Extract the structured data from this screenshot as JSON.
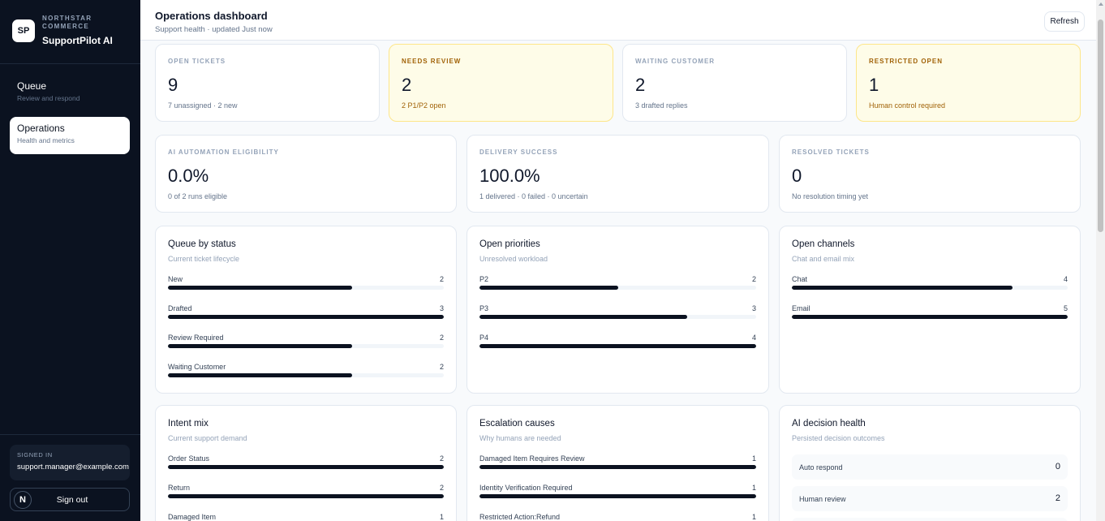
{
  "sidebar": {
    "logo": "SP",
    "org": "NORTHSTAR COMMERCE",
    "app_name": "SupportPilot AI",
    "nav": [
      {
        "label": "Queue",
        "sub": "Review and respond"
      },
      {
        "label": "Operations",
        "sub": "Health and metrics"
      }
    ],
    "signed_in_label": "SIGNED IN",
    "email": "support.manager@example.com",
    "avatar_letter": "N",
    "sign_out": "Sign out"
  },
  "header": {
    "title": "Operations dashboard",
    "subtitle": "Support health · updated Just now",
    "refresh": "Refresh"
  },
  "stats_top": [
    {
      "label": "OPEN TICKETS",
      "value": "9",
      "sub": "7 unassigned · 2 new"
    },
    {
      "label": "NEEDS REVIEW",
      "value": "2",
      "sub": "2 P1/P2 open"
    },
    {
      "label": "WAITING CUSTOMER",
      "value": "2",
      "sub": "3 drafted replies"
    },
    {
      "label": "RESTRICTED OPEN",
      "value": "1",
      "sub": "Human control required"
    }
  ],
  "stats_mid": [
    {
      "label": "AI AUTOMATION ELIGIBILITY",
      "value": "0.0%",
      "sub": "0 of 2 runs eligible"
    },
    {
      "label": "DELIVERY SUCCESS",
      "value": "100.0%",
      "sub": "1 delivered · 0 failed · 0 uncertain"
    },
    {
      "label": "RESOLVED TICKETS",
      "value": "0",
      "sub": "No resolution timing yet"
    }
  ],
  "panels": {
    "queue_status": {
      "title": "Queue by status",
      "sub": "Current ticket lifecycle",
      "max": 3,
      "rows": [
        {
          "label": "New",
          "count": 2
        },
        {
          "label": "Drafted",
          "count": 3
        },
        {
          "label": "Review Required",
          "count": 2
        },
        {
          "label": "Waiting Customer",
          "count": 2
        }
      ]
    },
    "priorities": {
      "title": "Open priorities",
      "sub": "Unresolved workload",
      "max": 4,
      "rows": [
        {
          "label": "P2",
          "count": 2
        },
        {
          "label": "P3",
          "count": 3
        },
        {
          "label": "P4",
          "count": 4
        }
      ]
    },
    "channels": {
      "title": "Open channels",
      "sub": "Chat and email mix",
      "max": 5,
      "rows": [
        {
          "label": "Chat",
          "count": 4
        },
        {
          "label": "Email",
          "count": 5
        }
      ]
    },
    "intent": {
      "title": "Intent mix",
      "sub": "Current support demand",
      "max": 2,
      "rows": [
        {
          "label": "Order Status",
          "count": 2
        },
        {
          "label": "Return",
          "count": 2
        },
        {
          "label": "Damaged Item",
          "count": 1
        }
      ]
    },
    "escalation": {
      "title": "Escalation causes",
      "sub": "Why humans are needed",
      "max": 1,
      "rows": [
        {
          "label": "Damaged Item Requires Review",
          "count": 1
        },
        {
          "label": "Identity Verification Required",
          "count": 1
        },
        {
          "label": "Restricted Action:Refund",
          "count": 1
        }
      ]
    },
    "ai_health": {
      "title": "AI decision health",
      "sub": "Persisted decision outcomes",
      "rows": [
        {
          "label": "Auto respond",
          "count": 0
        },
        {
          "label": "Human review",
          "count": 2
        }
      ]
    }
  },
  "colors": {
    "accent": "#0b1220",
    "warn_bg": "#fefce8",
    "warn_text": "#a16207"
  }
}
